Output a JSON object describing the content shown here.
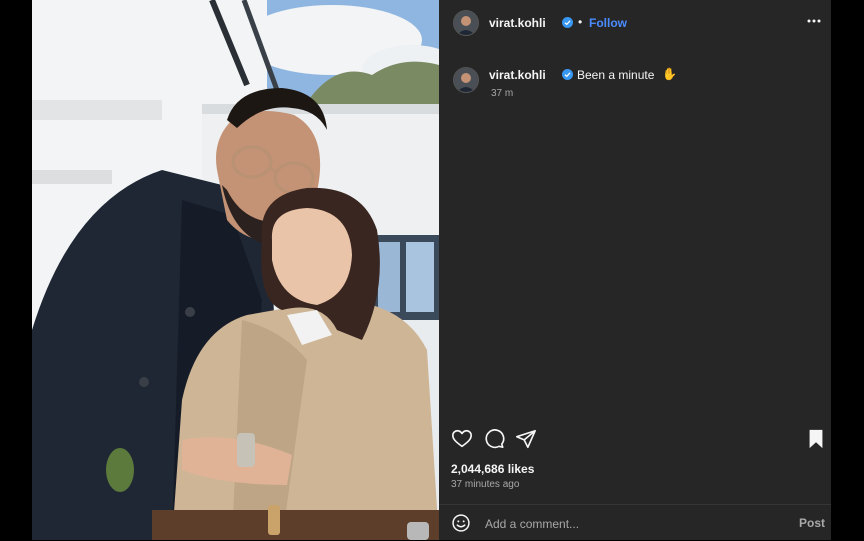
{
  "post": {
    "username": "virat.kohli",
    "follow_label": "Follow",
    "separator": "•",
    "caption": "Been a minute",
    "caption_emoji": "✋",
    "caption_time": "37 m",
    "likes": "2,044,686 likes",
    "posted_ago": "37 minutes ago"
  },
  "comment": {
    "placeholder": "Add a comment...",
    "post_label": "Post"
  },
  "icons": {
    "verified": "verified-badge-icon",
    "more": "more-options-icon",
    "like": "heart-icon",
    "comment": "comment-bubble-icon",
    "share": "share-paper-plane-icon",
    "save": "bookmark-icon",
    "emoji": "emoji-smile-icon"
  },
  "colors": {
    "background": "#262626",
    "accent": "#4a8cff",
    "verified": "#3897f0",
    "muted": "#a8a8a8"
  }
}
